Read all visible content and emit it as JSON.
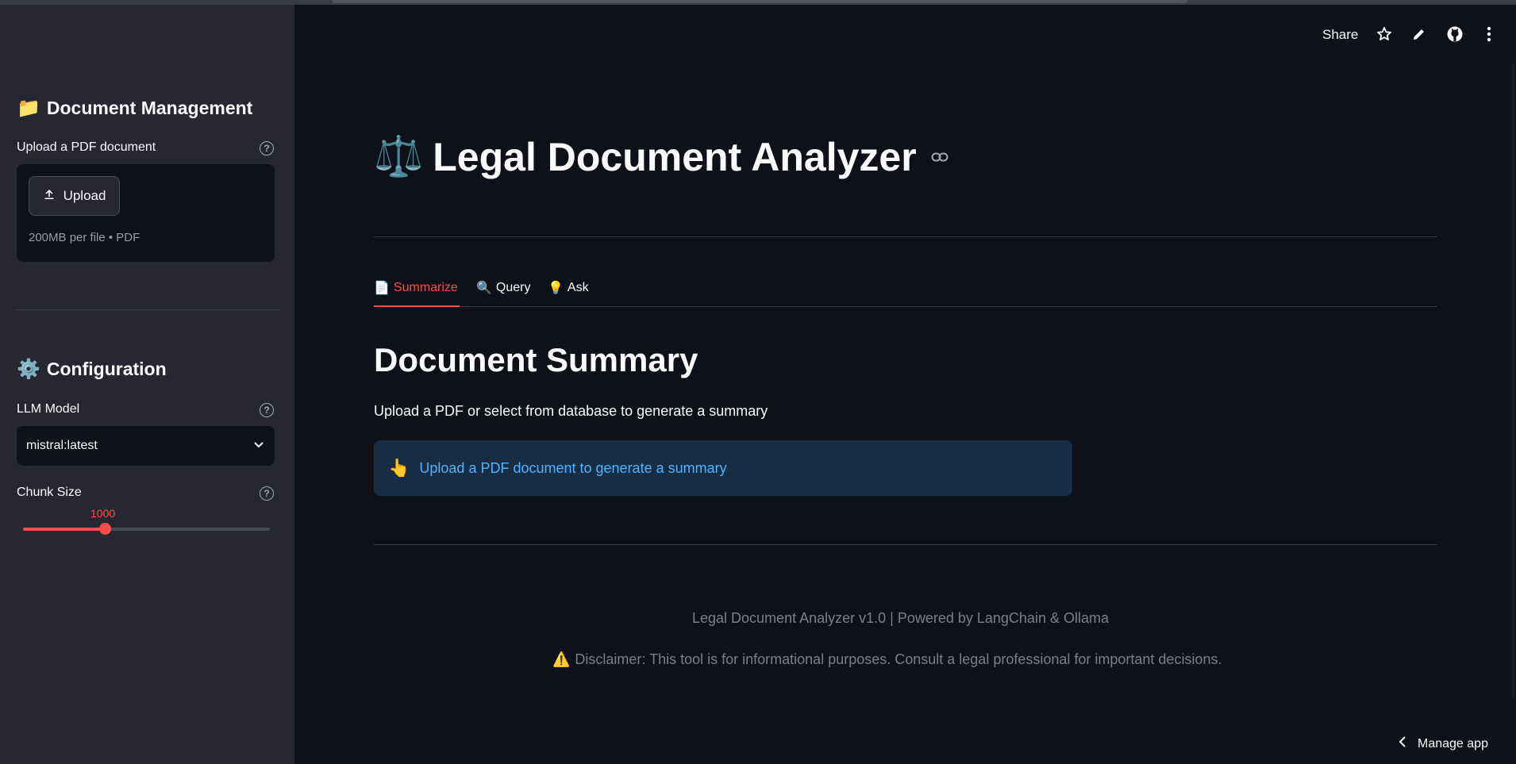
{
  "sidebar": {
    "doc_mgmt": {
      "emoji": "📁",
      "title": "Document Management"
    },
    "upload": {
      "label": "Upload a PDF document",
      "button_label": "Upload",
      "hint": "200MB per file • PDF"
    },
    "config": {
      "emoji": "⚙️",
      "title": "Configuration"
    },
    "llm_model": {
      "label": "LLM Model",
      "selected": "mistral:latest"
    },
    "chunk_size": {
      "label": "Chunk Size",
      "value": "1000",
      "fraction": 0.33
    }
  },
  "toolbar": {
    "share_label": "Share"
  },
  "main": {
    "title_emoji": "⚖️",
    "title": "Legal Document Analyzer",
    "tabs": [
      {
        "emoji": "📄",
        "label": "Summarize"
      },
      {
        "emoji": "🔍",
        "label": "Query"
      },
      {
        "emoji": "💡",
        "label": "Ask"
      }
    ],
    "section_title": "Document Summary",
    "section_desc": "Upload a PDF or select from database to generate a summary",
    "info": {
      "emoji": "👆",
      "text": "Upload a PDF document to generate a summary"
    },
    "footer_version": "Legal Document Analyzer v1.0 | Powered by LangChain & Ollama",
    "footer_disclaimer_emoji": "⚠️",
    "footer_disclaimer": "Disclaimer: This tool is for informational purposes. Consult a legal professional for important decisions."
  },
  "manage_app": "Manage app",
  "colors": {
    "accent": "#ff4b4b",
    "info_text": "#4fb3ff",
    "info_bg": "#172d43",
    "sidebar_bg": "#262730",
    "main_bg": "#0e1117"
  }
}
